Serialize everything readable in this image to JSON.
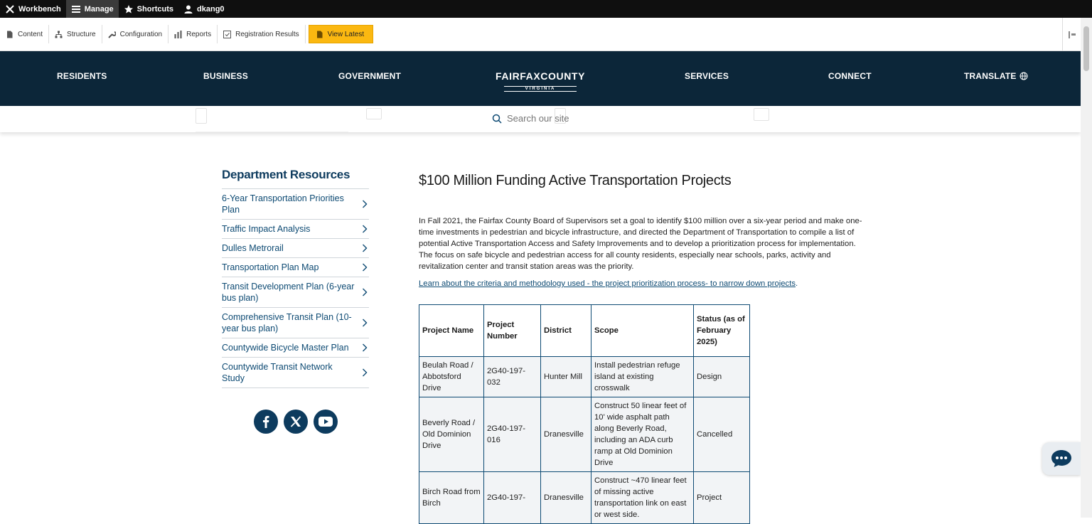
{
  "admin_bar": {
    "items": [
      {
        "label": "Workbench",
        "icon": "drupal-icon"
      },
      {
        "label": "Manage",
        "icon": "menu-icon"
      },
      {
        "label": "Shortcuts",
        "icon": "star-icon"
      },
      {
        "label": "dkang0",
        "icon": "user-icon"
      }
    ]
  },
  "sub_bar": {
    "items": [
      {
        "label": "Content",
        "icon": "file-icon"
      },
      {
        "label": "Structure",
        "icon": "structure-icon"
      },
      {
        "label": "Configuration",
        "icon": "wrench-icon"
      },
      {
        "label": "Reports",
        "icon": "bar-chart-icon"
      },
      {
        "label": "Registration Results",
        "icon": "checkbox-icon"
      }
    ],
    "view_latest": "View Latest"
  },
  "header": {
    "nav": [
      "RESIDENTS",
      "BUSINESS",
      "GOVERNMENT",
      "SERVICES",
      "CONNECT",
      "TRANSLATE"
    ],
    "logo_main": "FAIRFAXCOUNTY",
    "logo_sub": "VIRGINIA"
  },
  "search": {
    "placeholder": "Search our site"
  },
  "sidebar": {
    "title": "Department Resources",
    "items": [
      "6-Year Transportation Priorities Plan",
      "Traffic Impact Analysis",
      "Dulles Metrorail",
      "Transportation Plan Map",
      "Transit Development Plan (6-year bus plan)",
      "Comprehensive Transit Plan (10-year bus plan)",
      "Countywide Bicycle Master Plan",
      "Countywide Transit Network Study"
    ],
    "socials": [
      "facebook-icon",
      "x-icon",
      "youtube-icon"
    ]
  },
  "main": {
    "title": "$100 Million Funding Active Transportation Projects",
    "intro": "In Fall 2021, the Fairfax County Board of Supervisors set a goal to identify $100 million over a six-year period and make one-time investments in pedestrian and bicycle infrastructure, and directed the Department of Transportation to compile a list of potential Active Transportation Access and Safety Improvements and to develop a prioritization process for implementation. The focus on safe bicycle and pedestrian access for all county residents, especially near schools, parks, activity and revitalization center and transit station areas was the priority.",
    "link_text": "Learn about the criteria and methodology used - the project prioritization process- to narrow down projects",
    "link_suffix": "."
  },
  "table": {
    "headers": [
      "Project Name",
      "Project Number",
      "District",
      "Scope",
      "Status (as of February 2025)"
    ],
    "rows": [
      [
        "Beulah Road / Abbotsford Drive",
        "2G40-197-032",
        "Hunter Mill",
        "Install pedestrian refuge island at existing crosswalk",
        "Design"
      ],
      [
        "Beverly Road / Old Dominion Drive",
        "2G40-197-016",
        "Dranesville",
        "Construct 50 linear feet of 10' wide asphalt path along Beverly Road, including an ADA curb ramp at Old Dominion Drive",
        "Cancelled"
      ],
      [
        "Birch Road from Birch",
        "2G40-197-",
        "Dranesville",
        "Construct ~470 linear feet of missing active transportation link on east or west side.",
        "Project"
      ]
    ]
  }
}
